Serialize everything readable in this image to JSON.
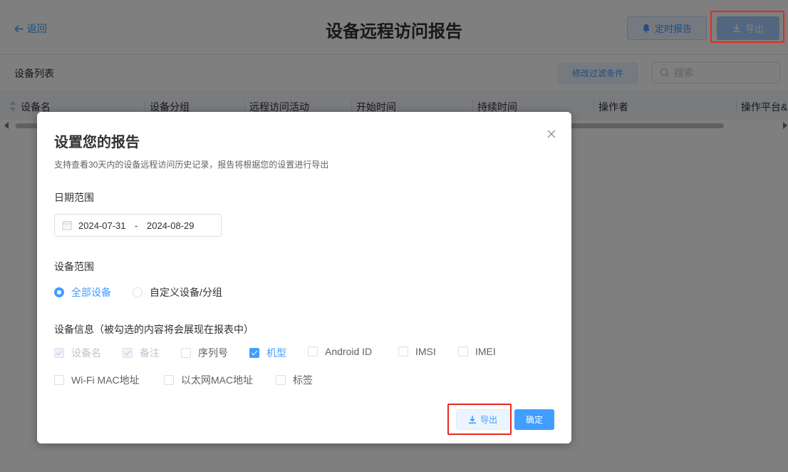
{
  "header": {
    "back_label": "返回",
    "title": "设备远程访问报告",
    "scheduled_report_label": "定时报告",
    "export_label": "导出"
  },
  "toolbar": {
    "list_title": "设备列表",
    "filter_label": "修改过滤条件",
    "search_placeholder": "搜索"
  },
  "table": {
    "columns": [
      "设备名",
      "设备分组",
      "远程访问活动",
      "开始时间",
      "持续时间",
      "操作者",
      "操作平台&"
    ]
  },
  "dialog": {
    "title": "设置您的报告",
    "description": "支持查看30天内的设备远程访问历史记录，报告将根据您的设置进行导出",
    "date_section_label": "日期范围",
    "date_start": "2024-07-31",
    "date_separator": "-",
    "date_end": "2024-08-29",
    "scope_section_label": "设备范围",
    "scope_options": [
      {
        "label": "全部设备",
        "selected": true
      },
      {
        "label": "自定义设备/分组",
        "selected": false
      }
    ],
    "info_section_label": "设备信息（被勾选的内容将会展现在报表中）",
    "info_fields": [
      {
        "label": "设备名",
        "checked": true,
        "disabled": true
      },
      {
        "label": "备注",
        "checked": true,
        "disabled": true
      },
      {
        "label": "序列号",
        "checked": false,
        "disabled": false
      },
      {
        "label": "机型",
        "checked": true,
        "disabled": false
      },
      {
        "label": "Android ID",
        "checked": false,
        "disabled": false
      },
      {
        "label": "IMSI",
        "checked": false,
        "disabled": false
      },
      {
        "label": "IMEI",
        "checked": false,
        "disabled": false
      },
      {
        "label": "Wi-Fi MAC地址",
        "checked": false,
        "disabled": false
      },
      {
        "label": "以太网MAC地址",
        "checked": false,
        "disabled": false
      },
      {
        "label": "标签",
        "checked": false,
        "disabled": false
      }
    ],
    "export_label": "导出",
    "confirm_label": "确定"
  },
  "colors": {
    "primary": "#409eff",
    "highlight": "#e8291e",
    "overlay": "rgba(0,0,0,0.5)"
  }
}
